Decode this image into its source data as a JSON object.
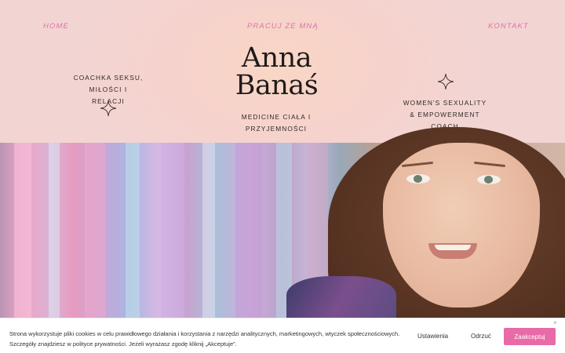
{
  "nav": {
    "home": "HOME",
    "work_with_me": "PRACUJ ZE MNĄ",
    "contact": "KONTAKT"
  },
  "hero": {
    "name_line1": "Anna",
    "name_line2": "Banaś",
    "tag_left_line1": "COACHKA SEKSU,",
    "tag_left_line2": "MIŁOŚCI I RELACJI",
    "tag_center": "MEDICINE CIAŁA I PRZYJEMNOŚCI",
    "tag_right_line1": "WOMEN'S SEXUALITY",
    "tag_right_line2": "& EMPOWERMENT COACH",
    "accent_color": "#e071a7"
  },
  "cookie": {
    "text_line1": "Strona wykorzystuje pliki cookies w celu prawidłowego działania i korzystania z narzędzi analitycznych, marketingowych, wtyczek społecznościowych.",
    "text_line2": "Szczegóły znajdziesz w polityce prywatności. Jeżeli wyrażasz zgodę kliknij „Akceptuje”.",
    "settings_label": "Ustawienia",
    "reject_label": "Odrzuć",
    "accept_label": "Zaakceptuj",
    "close_icon": "×",
    "accept_color": "#e86aa7"
  }
}
